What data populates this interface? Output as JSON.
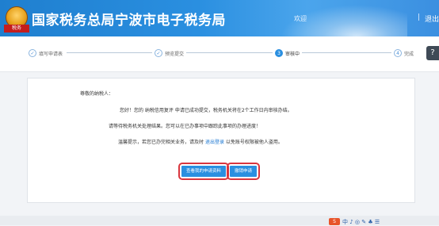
{
  "header": {
    "logo_badge": "税务",
    "title": "国家税务总局宁波市电子税务局",
    "welcome": "欢迎",
    "separator": "|",
    "logout": "退出"
  },
  "steps": [
    {
      "label": "填写申请表",
      "icon": "check-icon",
      "state": "done"
    },
    {
      "label": "预览提交",
      "icon": "check-icon",
      "state": "done"
    },
    {
      "label": "审核中",
      "number": "3",
      "state": "active"
    },
    {
      "label": "完成",
      "number": "4",
      "state": "pending"
    }
  ],
  "help_button": "?",
  "content": {
    "greeting": "尊敬的纳税人：",
    "line1": "您好！您的 纳税信用复评 申请已成功提交，税务机关将在2个工作日内审核办结。",
    "line2": "请等待税务机关处理结果。您可以在已办事项中跟踪此事项的办理进度！",
    "line3_prefix": "温馨提示，若您已办完相关业务，请及时",
    "line3_link": "退出登录",
    "line3_suffix": "以免账号权限被他人盗用。"
  },
  "buttons": {
    "view_materials": "查看我的申请资料",
    "withdraw": "撤销申请"
  },
  "tray": {
    "s_badge": "S",
    "icons": "中 ♪ ◎ ✎ ♣ ☰"
  },
  "colors": {
    "primary": "#2a8fe0",
    "highlight_border": "#d9363e",
    "header_blue": "#1f7fcf"
  }
}
